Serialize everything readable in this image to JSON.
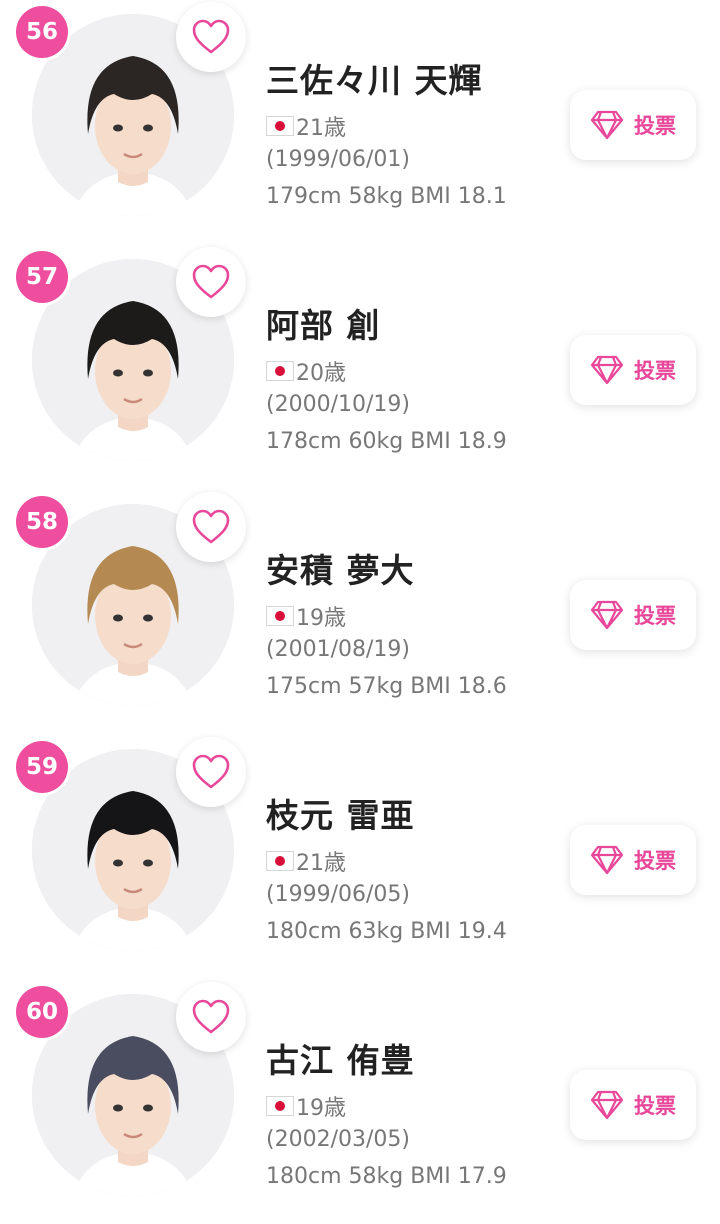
{
  "accent_color": "#ee4e9d",
  "icons": {
    "like": "heart-icon",
    "vote": "diamond-icon",
    "nationality": "japan-flag-icon"
  },
  "trainees": [
    {
      "rank": "56",
      "name": "三佐々川 天輝",
      "age": "21歳",
      "birth": "(1999/06/01)",
      "stats": "179cm 58kg BMI 18.1",
      "vote_label": "投票",
      "hair_color": "#2b2624"
    },
    {
      "rank": "57",
      "name": "阿部 創",
      "age": "20歳",
      "birth": "(2000/10/19)",
      "stats": "178cm 60kg BMI 18.9",
      "vote_label": "投票",
      "hair_color": "#1d1a1a"
    },
    {
      "rank": "58",
      "name": "安積 夢大",
      "age": "19歳",
      "birth": "(2001/08/19)",
      "stats": "175cm 57kg BMI 18.6",
      "vote_label": "投票",
      "hair_color": "#b48a52"
    },
    {
      "rank": "59",
      "name": "枝元 雷亜",
      "age": "21歳",
      "birth": "(1999/06/05)",
      "stats": "180cm 63kg BMI 19.4",
      "vote_label": "投票",
      "hair_color": "#151417"
    },
    {
      "rank": "60",
      "name": "古江 侑豊",
      "age": "19歳",
      "birth": "(2002/03/05)",
      "stats": "180cm 58kg BMI 17.9",
      "vote_label": "投票",
      "hair_color": "#4a4d60"
    }
  ]
}
